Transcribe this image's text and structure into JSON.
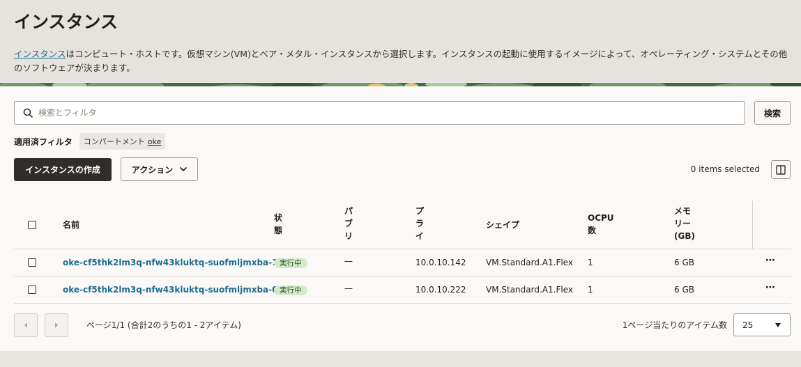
{
  "header": {
    "title": "インスタンス",
    "description_link": "インスタンス",
    "description_line1": "はコンピュート・ホストです。仮想マシン(VM)とベア・メタル・インスタンスから選択します。インスタンスの起動に使用するイメージによって、オペレーティング・システムとその他",
    "description_line2": "のソフトウェアが決まります。"
  },
  "search": {
    "placeholder": "検索とフィルタ",
    "button_label": "検索"
  },
  "filters": {
    "label": "適用済フィルタ",
    "chip_key": "コンパートメント",
    "chip_value": "oke"
  },
  "toolbar": {
    "create_label": "インスタンスの作成",
    "actions_label": "アクション",
    "selected_count": "0 items selected"
  },
  "table": {
    "headers": {
      "name": "名前",
      "state_1": "状",
      "state_2": "態",
      "public_1": "パ",
      "public_2": "ブ",
      "public_3": "リ",
      "private_1": "プ",
      "private_2": "ラ",
      "private_3": "イ",
      "shape": "シェイプ",
      "ocpu_1": "OCPU",
      "ocpu_2": "数",
      "memory_1": "メモ",
      "memory_2": "リー",
      "memory_3": "(GB)"
    },
    "rows": [
      {
        "name": "oke-cf5thk2lm3q-nfw43kluktq-suofmljmxba-1",
        "state": "実行中",
        "public_ip": "—",
        "private_ip": "10.0.10.142",
        "shape": "VM.Standard.A1.Flex",
        "ocpu": "1",
        "memory": "6 GB"
      },
      {
        "name": "oke-cf5thk2lm3q-nfw43kluktq-suofmljmxba-0",
        "state": "実行中",
        "public_ip": "—",
        "private_ip": "10.0.10.222",
        "shape": "VM.Standard.A1.Flex",
        "ocpu": "1",
        "memory": "6 GB"
      }
    ]
  },
  "pagination": {
    "summary": "ページ1/1 (合計2のうちの1 - 2アイテム)",
    "per_page_label": "1ページ当たりのアイテム数",
    "per_page_value": "25"
  },
  "colors": {
    "link": "#1f6e91",
    "primary_button": "#312d2a",
    "running_badge_bg": "#d4eacb",
    "banner_green": "#3f6b4a"
  }
}
